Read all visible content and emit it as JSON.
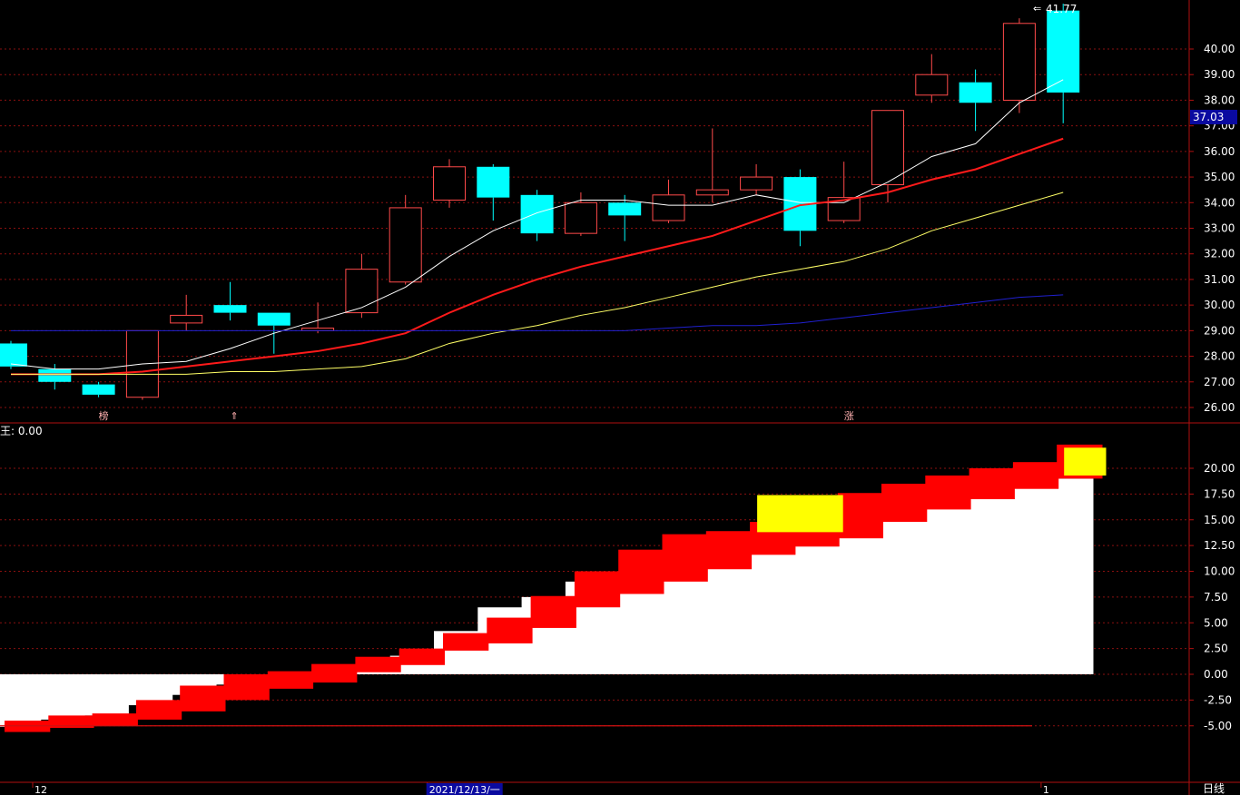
{
  "colors": {
    "background": "#000000",
    "frame": "#b01010",
    "grid": "#8a1010",
    "axis_text": "#ffffff",
    "up": "#ff4a4a",
    "down": "#00ffff",
    "ma5": "#ffffff",
    "ma10": "#ff1a1a",
    "ma20": "#ffff66",
    "ma60": "#2020d0",
    "price_tag_bg": "#0a0aa0",
    "lower_white": "#ffffff",
    "lower_red": "#ff0000",
    "lower_yellow": "#ffff00",
    "lower_ref_line": "#d01010"
  },
  "price_panel": {
    "high_label": "41.77",
    "last_price": "37.03",
    "markers": [
      {
        "label": "榜",
        "bar": 2
      },
      {
        "label": "⇑",
        "bar": 5
      },
      {
        "label": "涨",
        "bar": 19
      }
    ]
  },
  "indicator_panel": {
    "name_label": "王: 0.00"
  },
  "time_axis": {
    "labels": [
      {
        "text": "12",
        "bar": 0
      },
      {
        "text": "2021/12/13/一",
        "bar": 9,
        "highlight": true
      },
      {
        "text": "1",
        "bar": 23
      }
    ],
    "period": "日线"
  },
  "chart_data": [
    {
      "type": "candlestick",
      "ylim": [
        25.6,
        42.2
      ],
      "y_ticks": [
        "26.00",
        "27.00",
        "28.00",
        "29.00",
        "30.00",
        "31.00",
        "32.00",
        "33.00",
        "34.00",
        "35.00",
        "36.00",
        "37.00",
        "38.00",
        "39.00",
        "40.00"
      ],
      "grid": true,
      "candles": [
        {
          "o": 28.5,
          "h": 28.6,
          "l": 27.5,
          "c": 27.6
        },
        {
          "o": 27.5,
          "h": 27.7,
          "l": 26.7,
          "c": 27.0
        },
        {
          "o": 26.9,
          "h": 27.0,
          "l": 26.4,
          "c": 26.5
        },
        {
          "o": 26.4,
          "h": 29.0,
          "l": 26.3,
          "c": 29.0
        },
        {
          "o": 29.3,
          "h": 30.4,
          "l": 29.0,
          "c": 29.6
        },
        {
          "o": 30.0,
          "h": 30.9,
          "l": 29.4,
          "c": 29.7
        },
        {
          "o": 29.7,
          "h": 29.7,
          "l": 28.1,
          "c": 29.2
        },
        {
          "o": 29.0,
          "h": 30.1,
          "l": 28.9,
          "c": 29.1
        },
        {
          "o": 29.7,
          "h": 32.0,
          "l": 29.5,
          "c": 31.4
        },
        {
          "o": 30.9,
          "h": 34.3,
          "l": 30.8,
          "c": 33.8
        },
        {
          "o": 34.1,
          "h": 35.7,
          "l": 33.8,
          "c": 35.4
        },
        {
          "o": 35.4,
          "h": 35.5,
          "l": 33.3,
          "c": 34.2
        },
        {
          "o": 34.3,
          "h": 34.5,
          "l": 32.5,
          "c": 32.8
        },
        {
          "o": 32.8,
          "h": 34.4,
          "l": 32.7,
          "c": 34.0
        },
        {
          "o": 34.0,
          "h": 34.3,
          "l": 32.5,
          "c": 33.5
        },
        {
          "o": 33.3,
          "h": 34.9,
          "l": 33.2,
          "c": 34.3
        },
        {
          "o": 34.3,
          "h": 36.9,
          "l": 34.0,
          "c": 34.5
        },
        {
          "o": 34.5,
          "h": 35.5,
          "l": 34.3,
          "c": 35.0
        },
        {
          "o": 35.0,
          "h": 35.3,
          "l": 32.3,
          "c": 32.9
        },
        {
          "o": 33.3,
          "h": 35.6,
          "l": 33.2,
          "c": 34.2
        },
        {
          "o": 34.7,
          "h": 37.6,
          "l": 34.0,
          "c": 37.6
        },
        {
          "o": 38.2,
          "h": 39.8,
          "l": 37.9,
          "c": 39.0
        },
        {
          "o": 38.7,
          "h": 39.2,
          "l": 36.8,
          "c": 37.9
        },
        {
          "o": 38.0,
          "h": 41.2,
          "l": 37.5,
          "c": 41.0
        },
        {
          "o": 41.5,
          "h": 41.77,
          "l": 37.1,
          "c": 38.3
        }
      ],
      "series": [
        {
          "key": "ma5",
          "values": [
            27.7,
            27.5,
            27.5,
            27.7,
            27.8,
            28.3,
            28.9,
            29.4,
            29.9,
            30.7,
            31.9,
            32.9,
            33.6,
            34.1,
            34.1,
            33.9,
            33.9,
            34.3,
            34.0,
            34.0,
            34.8,
            35.8,
            36.3,
            37.9,
            38.8
          ]
        },
        {
          "key": "ma10",
          "values": [
            27.3,
            27.3,
            27.3,
            27.4,
            27.6,
            27.8,
            28.0,
            28.2,
            28.5,
            28.9,
            29.7,
            30.4,
            31.0,
            31.5,
            31.9,
            32.3,
            32.7,
            33.3,
            33.9,
            34.1,
            34.4,
            34.9,
            35.3,
            35.9,
            36.5
          ]
        },
        {
          "key": "ma20",
          "values": [
            27.3,
            27.3,
            27.3,
            27.3,
            27.3,
            27.4,
            27.4,
            27.5,
            27.6,
            27.9,
            28.5,
            28.9,
            29.2,
            29.6,
            29.9,
            30.3,
            30.7,
            31.1,
            31.4,
            31.7,
            32.2,
            32.9,
            33.4,
            33.9,
            34.4
          ]
        },
        {
          "key": "ma60",
          "values": [
            29.0,
            29.0,
            29.0,
            29.0,
            29.0,
            29.0,
            29.0,
            29.0,
            29.0,
            29.0,
            29.0,
            29.0,
            29.0,
            29.0,
            29.0,
            29.1,
            29.2,
            29.2,
            29.3,
            29.5,
            29.7,
            29.9,
            30.1,
            30.3,
            30.4
          ]
        }
      ]
    },
    {
      "type": "bar",
      "ylim": [
        -9.0,
        23.0
      ],
      "y_ticks": [
        "-5.00",
        "-2.50",
        "0.00",
        "2.50",
        "5.00",
        "7.50",
        "10.00",
        "12.50",
        "15.00",
        "17.50",
        "20.00"
      ],
      "reference_line": -5.0,
      "white_steps": [
        [
          -5.1,
          0.0
        ],
        [
          -4.4,
          0.0
        ],
        [
          -4.0,
          0.0
        ],
        [
          -3.0,
          0.0
        ],
        [
          -2.0,
          0.0
        ],
        [
          -1.0,
          0.0
        ],
        [
          -0.6,
          0.0
        ],
        [
          0.1,
          0.0
        ],
        [
          0.5,
          0.0
        ],
        [
          1.8,
          0.0
        ],
        [
          4.2,
          0.0
        ],
        [
          6.5,
          0.0
        ],
        [
          7.5,
          0.0
        ],
        [
          9.0,
          0.0
        ],
        [
          10.0,
          0.0
        ],
        [
          11.5,
          0.0
        ],
        [
          12.8,
          0.0
        ],
        [
          13.8,
          0.0
        ],
        [
          14.2,
          0.0
        ],
        [
          15.0,
          0.0
        ],
        [
          15.6,
          0.0
        ],
        [
          16.6,
          0.0
        ],
        [
          17.5,
          0.0
        ],
        [
          18.2,
          0.0
        ],
        [
          19.0,
          0.0
        ]
      ],
      "red_steps": [
        [
          -5.6,
          -4.5
        ],
        [
          -5.2,
          -4.0
        ],
        [
          -5.0,
          -3.8
        ],
        [
          -4.4,
          -2.5
        ],
        [
          -3.6,
          -1.1
        ],
        [
          -2.5,
          0.0
        ],
        [
          -1.4,
          0.3
        ],
        [
          -0.8,
          1.0
        ],
        [
          0.2,
          1.7
        ],
        [
          0.9,
          2.5
        ],
        [
          2.3,
          4.0
        ],
        [
          3.0,
          5.5
        ],
        [
          4.5,
          7.6
        ],
        [
          6.5,
          10.0
        ],
        [
          7.8,
          12.1
        ],
        [
          9.0,
          13.6
        ],
        [
          10.2,
          13.9
        ],
        [
          11.6,
          14.8
        ],
        [
          12.4,
          15.6
        ],
        [
          13.2,
          17.6
        ],
        [
          14.8,
          18.5
        ],
        [
          16.0,
          19.3
        ],
        [
          17.0,
          20.0
        ],
        [
          18.0,
          20.6
        ],
        [
          19.0,
          22.3
        ]
      ],
      "yellow_blocks": [
        {
          "from_bar": 17,
          "to_bar": 19,
          "y0": 13.8,
          "y1": 17.4
        },
        {
          "from_bar": 24,
          "to_bar": 25,
          "y0": 19.3,
          "y1": 22.0
        }
      ]
    }
  ]
}
